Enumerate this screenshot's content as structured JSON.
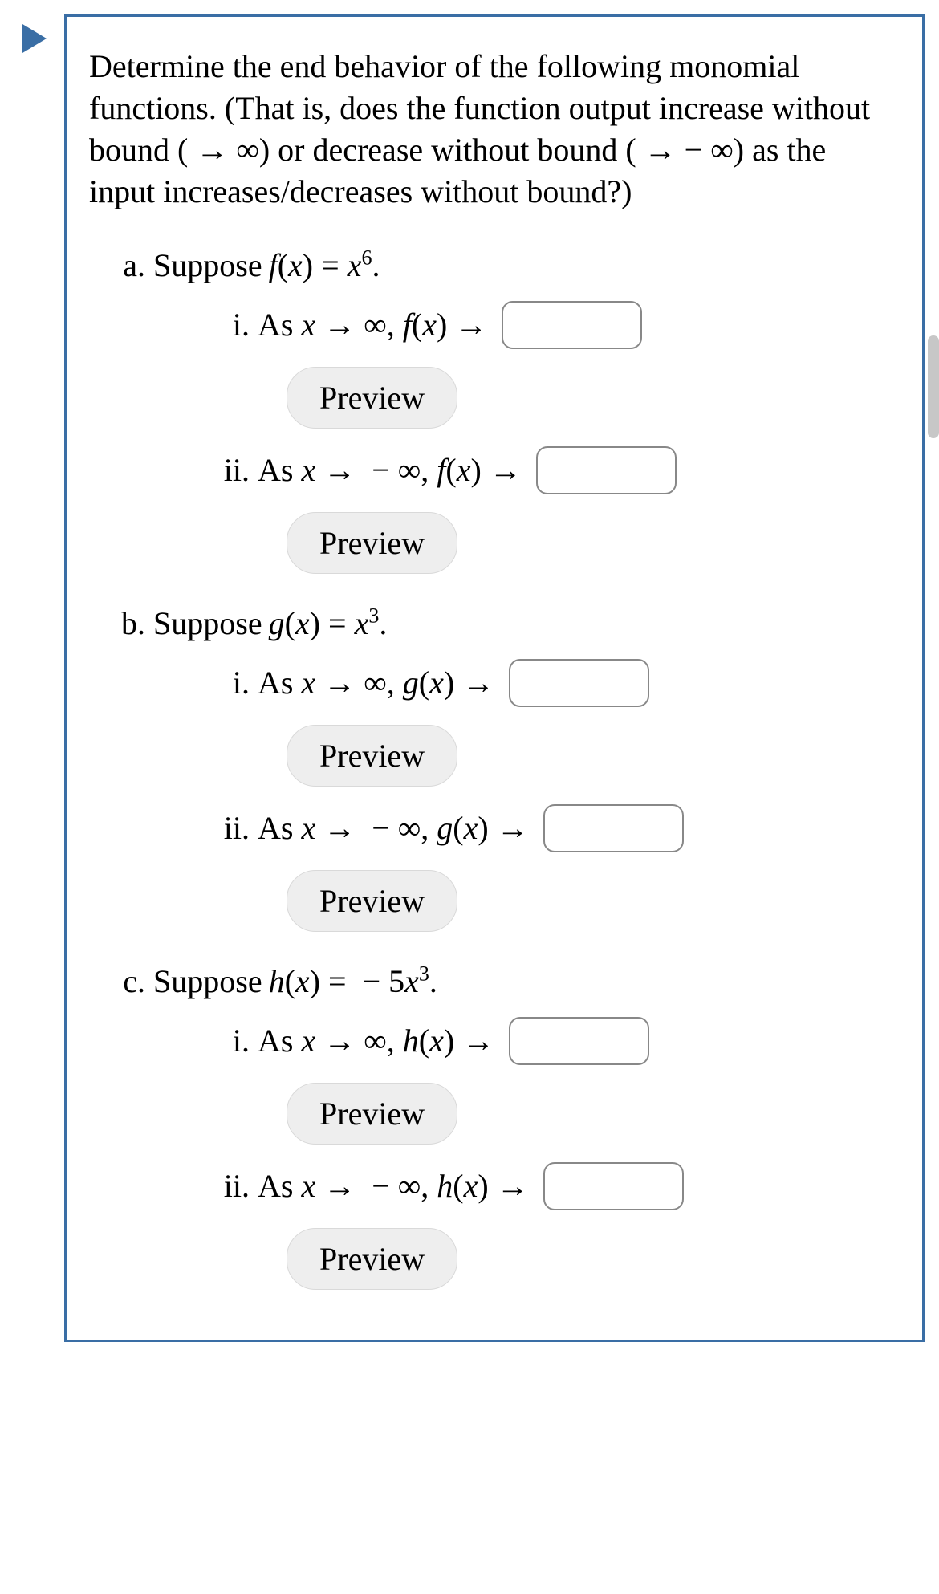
{
  "intro": "Determine the end behavior of the following monomial functions. (That is, does the function output increase without bound ( → ∞) or decrease without bound ( → − ∞) as the input increases/decreases without bound?)",
  "preview_label": "Preview",
  "parts": {
    "a": {
      "prompt_prefix": "Suppose ",
      "fn_var": "f",
      "x_var": "x",
      "rhs_coef": "",
      "rhs_power": "6",
      "sub_i_text": "As x → ∞, f(x) →",
      "sub_ii_text": "As x → − ∞, f(x) →"
    },
    "b": {
      "prompt_prefix": "Suppose ",
      "fn_var": "g",
      "x_var": "x",
      "rhs_coef": "",
      "rhs_power": "3",
      "sub_i_text": "As x → ∞, g(x) →",
      "sub_ii_text": "As x → − ∞, g(x) →"
    },
    "c": {
      "prompt_prefix": "Suppose ",
      "fn_var": "h",
      "x_var": "x",
      "rhs_coef": "− 5",
      "rhs_power": "3",
      "sub_i_text": "As x → ∞, h(x) →",
      "sub_ii_text": "As x → − ∞, h(x) →"
    }
  }
}
